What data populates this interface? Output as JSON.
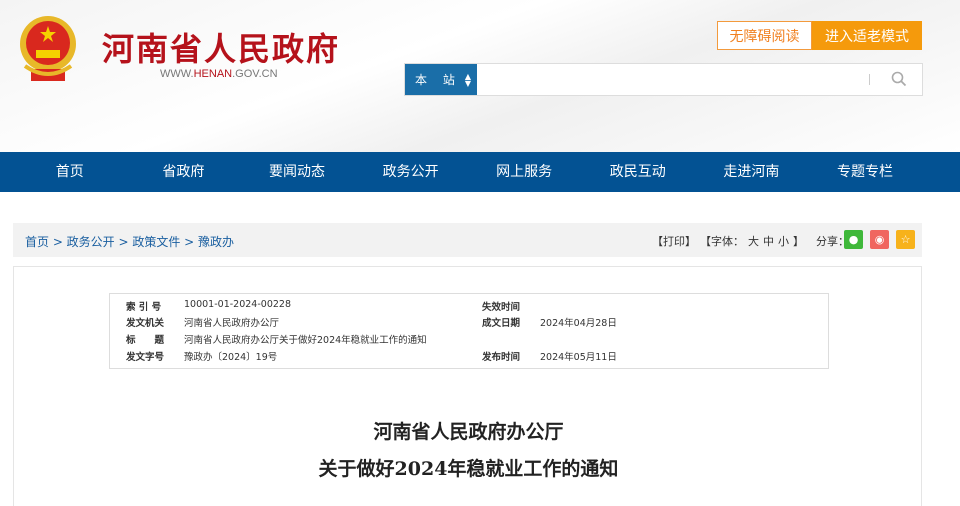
{
  "header": {
    "site_title": "河南省人民政府",
    "url_prefix": "WWW.",
    "url_mid": "HENAN",
    "url_suffix": ".GOV.CN",
    "a11y": "无障碍阅读",
    "elder": "进入适老模式"
  },
  "search": {
    "scope": "本 站",
    "placeholder": ""
  },
  "nav": [
    "首页",
    "省政府",
    "要闻动态",
    "政务公开",
    "网上服务",
    "政民互动",
    "走进河南",
    "专题专栏"
  ],
  "breadcrumb": "首页 > 政务公开 > 政策文件 > 豫政办",
  "tools": {
    "print": "【打印】",
    "font": "【字体：",
    "large": "大",
    "medium": "中",
    "small": "小",
    "font_end": "】",
    "share": "分享："
  },
  "colors": {
    "nav": "#035293",
    "brand_red": "#b5121b",
    "orange": "#f59a0c",
    "wechat": "#3fb83a",
    "weibo": "#f06660",
    "fav": "#f7b21b"
  },
  "meta": {
    "index_label": "索 引 号",
    "index": "10001-01-2024-00228",
    "expire_label": "失效时间",
    "expire": "",
    "org_label": "发文机关",
    "org": "河南省人民政府办公厅",
    "date_label": "成文日期",
    "date": "2024年04月28日",
    "title_label": "标　　题",
    "title": "河南省人民政府办公厅关于做好2024年稳就业工作的通知",
    "num_label": "发文字号",
    "num": "豫政办〔2024〕19号",
    "pub_label": "发布时间",
    "pub": "2024年05月11日"
  },
  "doc": {
    "line1": "河南省人民政府办公厅",
    "line2": "关于做好2024年稳就业工作的通知"
  }
}
